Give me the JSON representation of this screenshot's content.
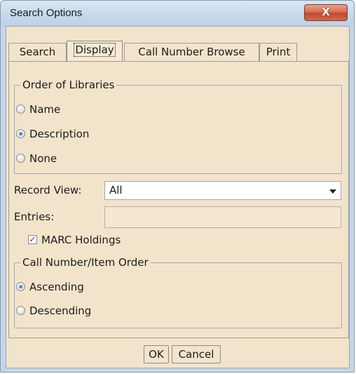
{
  "window": {
    "title": "Search Options",
    "close_glyph": "X"
  },
  "tabs": [
    {
      "label": "Search"
    },
    {
      "label": "Display"
    },
    {
      "label": "Call Number Browse"
    },
    {
      "label": "Print"
    }
  ],
  "active_tab": "Display",
  "order_of_libraries": {
    "legend": "Order of Libraries",
    "options": [
      {
        "label": "Name",
        "checked": false
      },
      {
        "label": "Description",
        "checked": true
      },
      {
        "label": "None",
        "checked": false
      }
    ]
  },
  "record_view": {
    "label": "Record View:",
    "value": "All"
  },
  "entries": {
    "label": "Entries:",
    "value": ""
  },
  "marc_holdings": {
    "label": "MARC Holdings",
    "checked": true
  },
  "call_number_order": {
    "legend": "Call Number/Item Order",
    "options": [
      {
        "label": "Ascending",
        "checked": true
      },
      {
        "label": "Descending",
        "checked": false
      }
    ]
  },
  "buttons": {
    "ok": "OK",
    "cancel": "Cancel"
  },
  "icons": {
    "close": "close-icon",
    "dropdown": "chevron-down-icon",
    "check": "checkmark-icon"
  }
}
